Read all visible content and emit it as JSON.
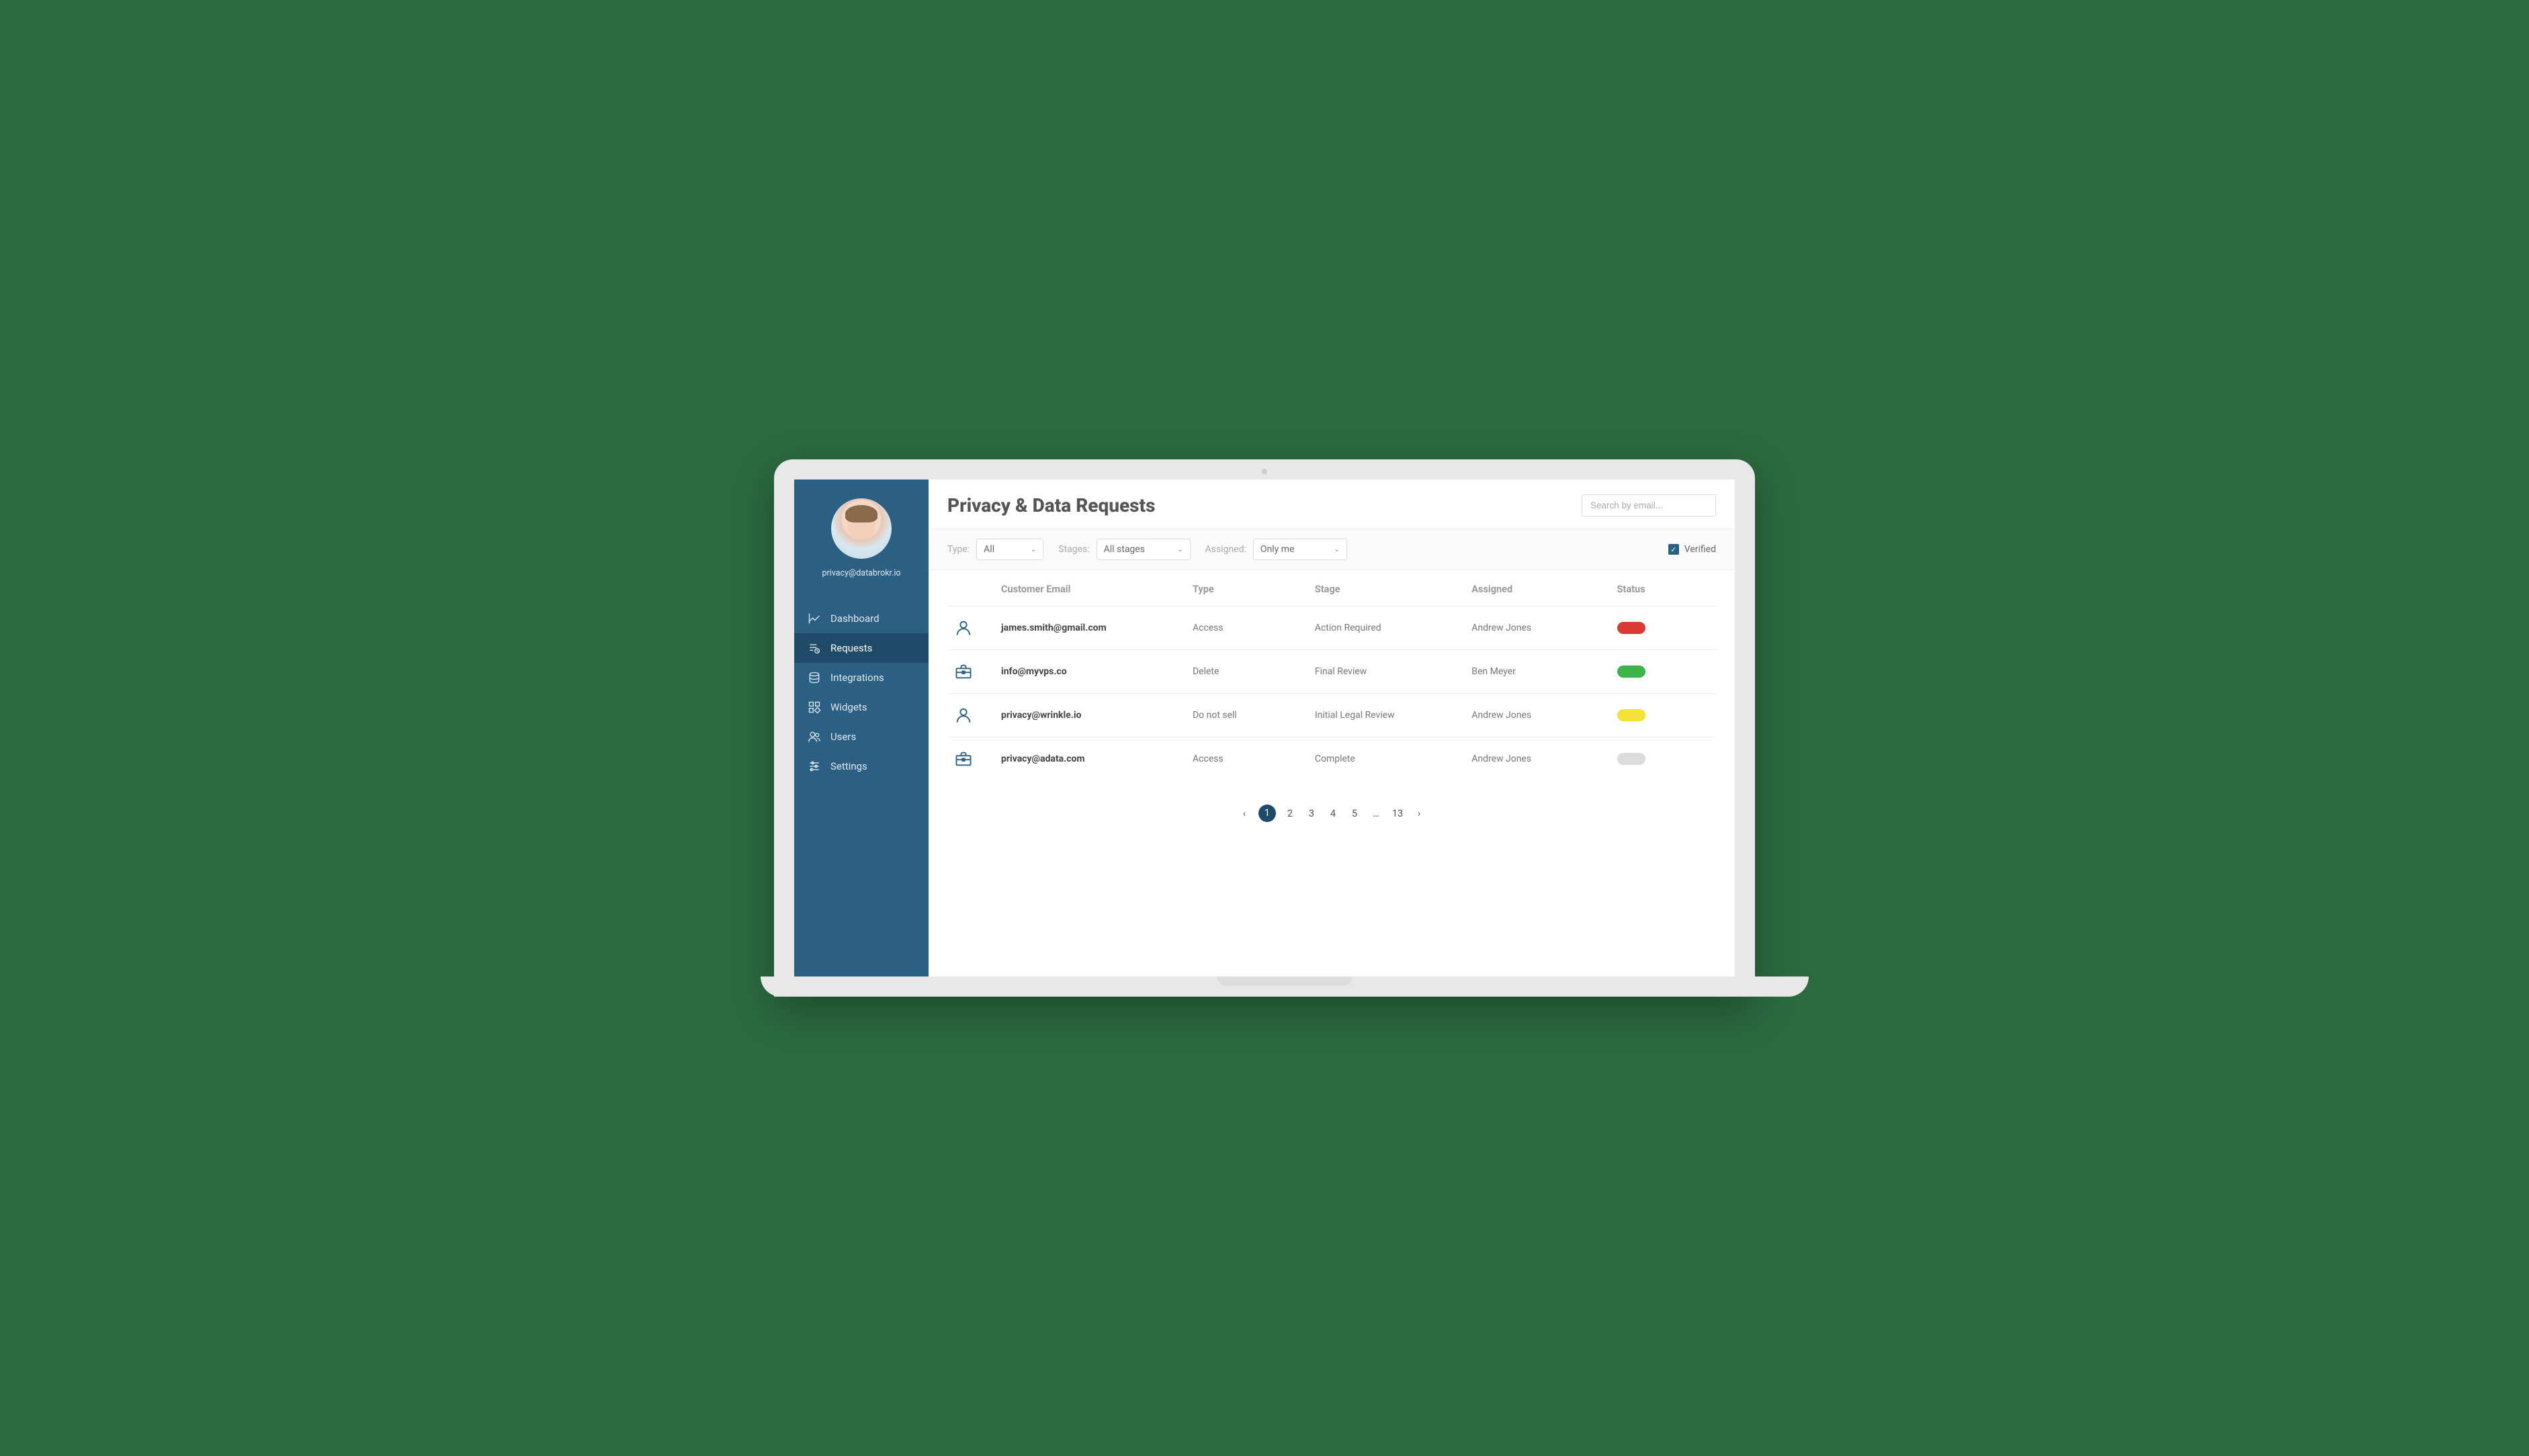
{
  "profile": {
    "email": "privacy@databrokr.io"
  },
  "sidebar": {
    "items": [
      {
        "label": "Dashboard"
      },
      {
        "label": "Requests"
      },
      {
        "label": "Integrations"
      },
      {
        "label": "Widgets"
      },
      {
        "label": "Users"
      },
      {
        "label": "Settings"
      }
    ]
  },
  "header": {
    "title": "Privacy & Data Requests",
    "search_placeholder": "Search by email..."
  },
  "filters": {
    "type_label": "Type:",
    "type_value": "All",
    "stages_label": "Stages:",
    "stages_value": "All stages",
    "assigned_label": "Assigned:",
    "assigned_value": "Only me",
    "verified_label": "Verified",
    "verified_checked": true
  },
  "table": {
    "headers": {
      "email": "Customer Email",
      "type": "Type",
      "stage": "Stage",
      "assigned": "Assigned",
      "status": "Status"
    },
    "rows": [
      {
        "icon": "person",
        "email": "james.smith@gmail.com",
        "type": "Access",
        "stage": "Action Required",
        "assigned": "Andrew Jones",
        "status_color": "#d93a33"
      },
      {
        "icon": "briefcase",
        "email": "info@myvps.co",
        "type": "Delete",
        "stage": "Final Review",
        "assigned": "Ben Meyer",
        "status_color": "#3bb54a"
      },
      {
        "icon": "person",
        "email": "privacy@wrinkle.io",
        "type": "Do not sell",
        "stage": "Initial Legal Review",
        "assigned": "Andrew Jones",
        "status_color": "#f5e236"
      },
      {
        "icon": "briefcase",
        "email": "privacy@adata.com",
        "type": "Access",
        "stage": "Complete",
        "assigned": "Andrew Jones",
        "status_color": "#dcdcdc"
      }
    ]
  },
  "pagination": {
    "prev": "‹",
    "pages": [
      "1",
      "2",
      "3",
      "4",
      "5",
      "…",
      "13"
    ],
    "next": "›",
    "active": "1"
  }
}
